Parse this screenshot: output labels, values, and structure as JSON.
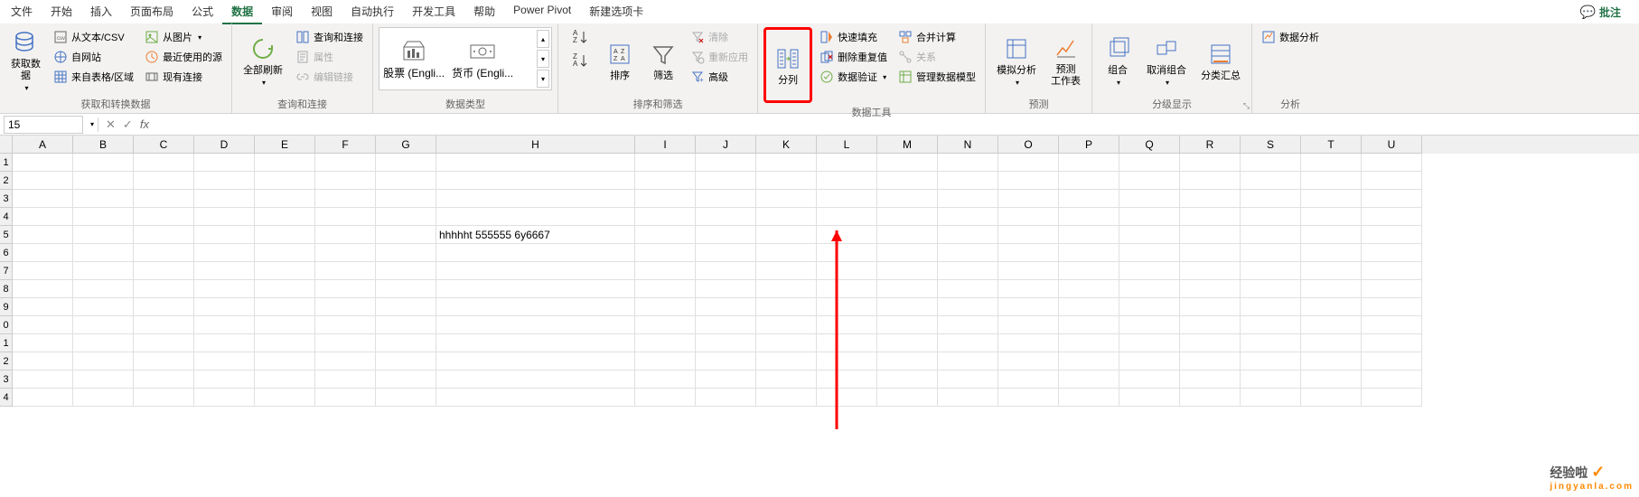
{
  "menubar": {
    "items": [
      "文件",
      "开始",
      "插入",
      "页面布局",
      "公式",
      "数据",
      "审阅",
      "视图",
      "自动执行",
      "开发工具",
      "帮助",
      "Power Pivot",
      "新建选项卡"
    ],
    "active_index": 5,
    "comment": "批注"
  },
  "ribbon": {
    "get_transform": {
      "label": "获取和转换数据",
      "get_data": "获取数\n据",
      "from_csv": "从文本/CSV",
      "from_web": "自网站",
      "from_table": "来自表格/区域",
      "from_pic": "从图片",
      "recent": "最近使用的源",
      "existing": "现有连接"
    },
    "queries": {
      "label": "查询和连接",
      "refresh_all": "全部刷新",
      "queries_conn": "查询和连接",
      "properties": "属性",
      "edit_links": "编辑链接"
    },
    "data_types": {
      "label": "数据类型",
      "stocks": "股票 (Engli...",
      "currency": "货币 (Engli..."
    },
    "sort_filter": {
      "label": "排序和筛选",
      "sort": "排序",
      "filter": "筛选",
      "clear": "清除",
      "reapply": "重新应用",
      "advanced": "高级"
    },
    "data_tools": {
      "label": "数据工具",
      "text_to_cols": "分列",
      "flash_fill": "快速填充",
      "remove_dup": "删除重复值",
      "data_validation": "数据验证",
      "consolidate": "合并计算",
      "relationships": "关系",
      "manage_model": "管理数据模型"
    },
    "forecast": {
      "label": "预测",
      "whatif": "模拟分析",
      "forecast_sheet": "预测\n工作表"
    },
    "outline": {
      "label": "分级显示",
      "group": "组合",
      "ungroup": "取消组合",
      "subtotal": "分类汇总"
    },
    "analyze": {
      "label": "分析",
      "data_analysis": "数据分析"
    }
  },
  "namebox": {
    "value": "15"
  },
  "columns": [
    "A",
    "B",
    "C",
    "D",
    "E",
    "F",
    "G",
    "H",
    "I",
    "J",
    "K",
    "L",
    "M",
    "N",
    "O",
    "P",
    "Q",
    "R",
    "S",
    "T",
    "U"
  ],
  "rows": [
    "1",
    "2",
    "3",
    "4",
    "5",
    "6",
    "7",
    "8",
    "9",
    "0",
    "1",
    "2",
    "3",
    "4"
  ],
  "cell_content": {
    "h5": "hhhhht 555555 6y6667"
  },
  "watermark": {
    "text": "经验啦",
    "sub": "jingyanla.com"
  }
}
